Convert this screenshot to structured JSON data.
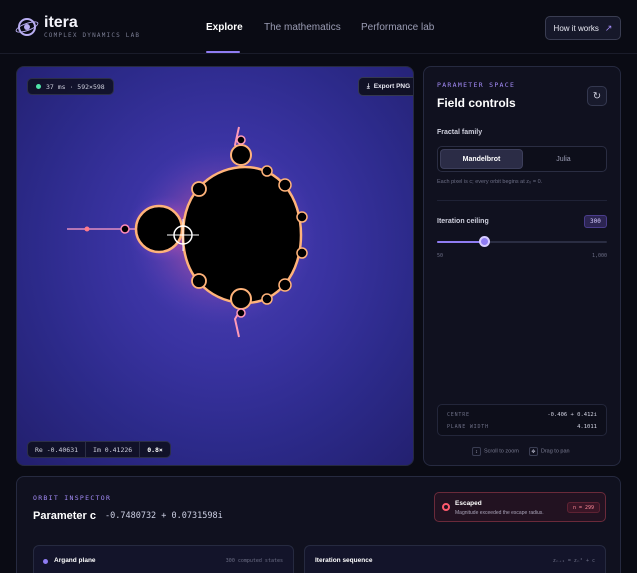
{
  "header": {
    "brand": "itera",
    "brand_sub": "COMPLEX DYNAMICS LAB",
    "nav": [
      {
        "label": "Explore",
        "active": true
      },
      {
        "label": "The mathematics",
        "active": false
      },
      {
        "label": "Performance lab",
        "active": false
      }
    ],
    "how_label": "How it works",
    "how_icon": "arrow-up-right-icon"
  },
  "canvas": {
    "fps_text": "37 ms · 592×598",
    "export_label": "Export PNG",
    "re": "Re -0.40631",
    "im": "Im 0.41226",
    "zoom": "0.8×"
  },
  "controls": {
    "section_label": "PARAMETER SPACE",
    "title": "Field controls",
    "family_label": "Fractal family",
    "family_options": [
      "Mandelbrot",
      "Julia"
    ],
    "family_selected": "Mandelbrot",
    "family_hint": "Each pixel is c; every orbit begins at z₀ = 0.",
    "iteration_label": "Iteration ceiling",
    "iteration_value": "300",
    "iteration_fraction": 0.25,
    "slider_min": "50",
    "slider_max": "1,000",
    "centre_label": "CENTRE",
    "centre_value": "-0.406 + 0.412i",
    "width_label": "PLANE WIDTH",
    "width_value": "4.1011",
    "hint_scroll": "Scroll to zoom",
    "hint_drag": "Drag to pan"
  },
  "inspector": {
    "section_label": "ORBIT INSPECTOR",
    "title": "Parameter c",
    "value": "-0.7480732 + 0.0731598i",
    "status_title": "Escaped",
    "status_sub": "Magnitude exceeded the escape radius.",
    "status_badge": "n = 299",
    "card_argand": "Argand plane",
    "card_argand_right": "300 computed states",
    "card_sequence": "Iteration sequence",
    "card_sequence_right": "zₙ₊₁ = zₙ² + c"
  },
  "colors": {
    "accent": "#8f7cf2",
    "escape": "#ff5a6e",
    "ok": "#4fe3a8"
  }
}
